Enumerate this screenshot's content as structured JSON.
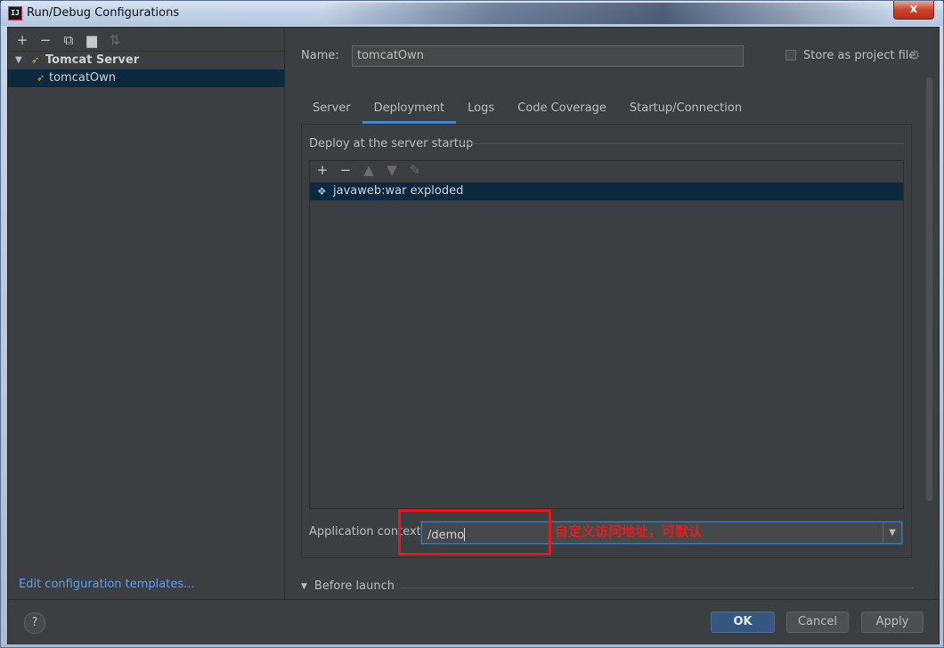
{
  "window": {
    "title": "Run/Debug Configurations",
    "close_label": "x",
    "app_icon_text": "IJ"
  },
  "left": {
    "toolbar": [
      {
        "name": "add-icon",
        "glyph": "+"
      },
      {
        "name": "remove-icon",
        "glyph": "−"
      },
      {
        "name": "copy-icon",
        "glyph": "⧉"
      },
      {
        "name": "folder-icon",
        "glyph": "▆"
      },
      {
        "name": "sort-icon",
        "glyph": "⇅"
      }
    ],
    "tree": {
      "group_label": "Tomcat Server",
      "item_label": "tomcatOwn"
    },
    "edit_templates_label": "Edit configuration templates..."
  },
  "config": {
    "name_label": "Name:",
    "name_value": "tomcatOwn",
    "store_label": "Store as project file",
    "store_checked": false
  },
  "tabs": [
    {
      "label": "Server",
      "active": false
    },
    {
      "label": "Deployment",
      "active": true
    },
    {
      "label": "Logs",
      "active": false
    },
    {
      "label": "Code Coverage",
      "active": false
    },
    {
      "label": "Startup/Connection",
      "active": false
    }
  ],
  "deployment": {
    "section_title": "Deploy at the server startup",
    "artifacts": [
      "javaweb:war exploded"
    ],
    "app_context_label": "Application context:",
    "app_context_value": "/demo",
    "annotation_text": "自定义访问地址，可默认"
  },
  "before_launch_label": "Before launch",
  "buttons": {
    "help": "?",
    "ok": "OK",
    "cancel": "Cancel",
    "apply": "Apply"
  },
  "colors": {
    "selection": "#0d293e",
    "link": "#589df6",
    "annotation": "#e0191e",
    "ok_button": "#365880"
  }
}
